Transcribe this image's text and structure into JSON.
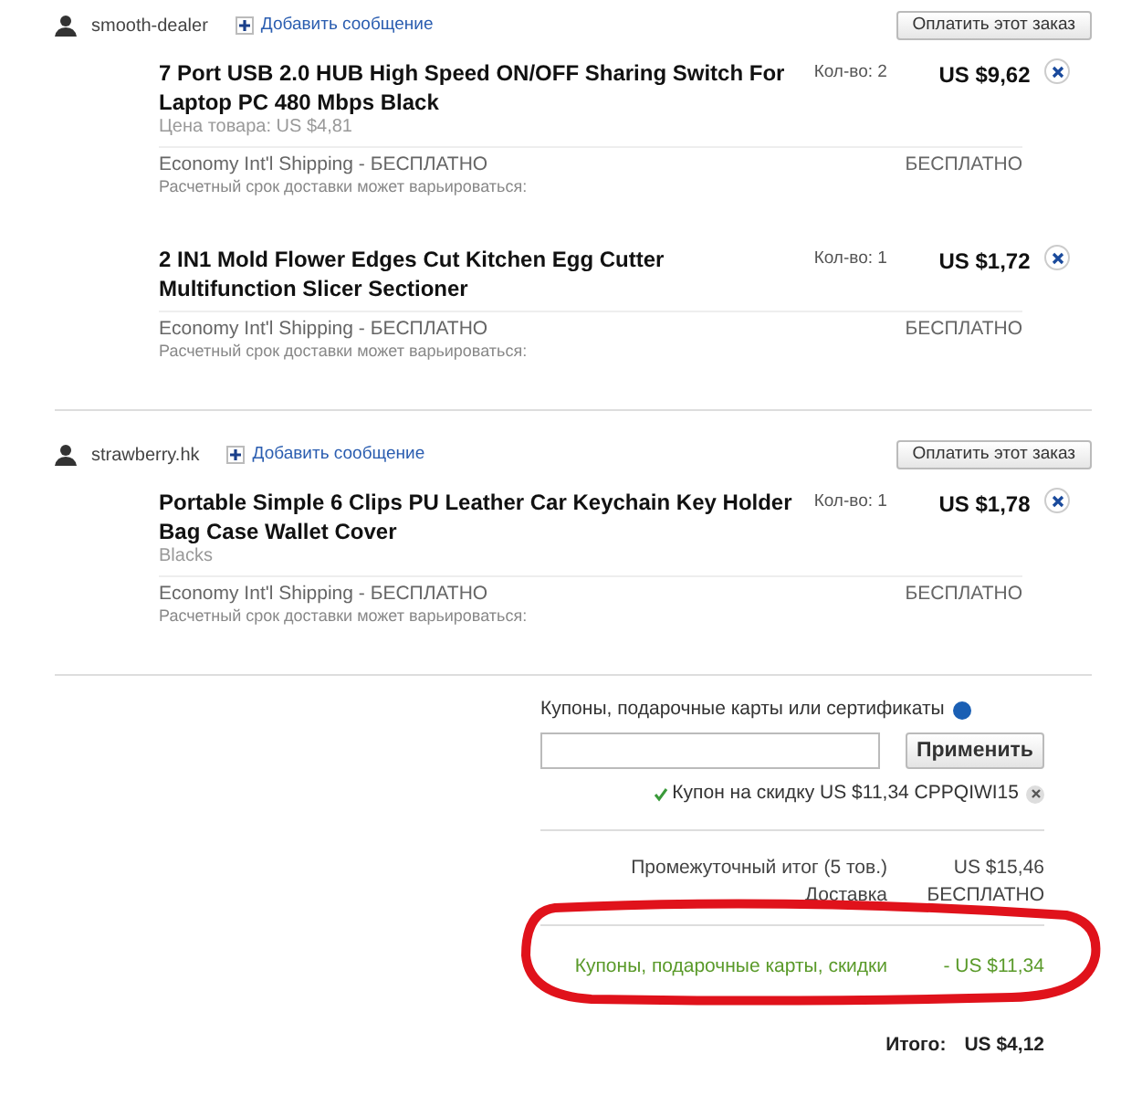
{
  "sellers": [
    {
      "name": "smooth-dealer",
      "add_message": "Добавить сообщение",
      "pay_button": "Оплатить этот заказ",
      "items": [
        {
          "title": "7 Port USB 2.0 HUB High Speed ON/OFF Sharing Switch For Laptop PC 480 Mbps Black",
          "subtitle": "Цена товара: US $4,81",
          "qty": "Кол-во: 2",
          "price": "US $9,62",
          "shipping": "Economy Int'l Shipping - БЕСПЛАТНО",
          "shipping_note": "Расчетный срок доставки может варьироваться:",
          "shipping_price": "БЕСПЛАТНО"
        },
        {
          "title": "2 IN1 Mold Flower Edges Cut Kitchen Egg Cutter Multifunction Slicer Sectioner",
          "qty": "Кол-во: 1",
          "price": "US $1,72",
          "shipping": "Economy Int'l Shipping - БЕСПЛАТНО",
          "shipping_note": "Расчетный срок доставки может варьироваться:",
          "shipping_price": "БЕСПЛАТНО"
        }
      ]
    },
    {
      "name": "strawberry.hk",
      "add_message": "Добавить сообщение",
      "pay_button": "Оплатить этот заказ",
      "items": [
        {
          "title": "Portable Simple 6 Clips PU Leather Car Keychain Key Holder Bag Case Wallet Cover",
          "subtitle": "Blacks",
          "qty": "Кол-во: 1",
          "price": "US $1,78",
          "shipping": "Economy Int'l Shipping - БЕСПЛАТНО",
          "shipping_note": "Расчетный срок доставки может варьироваться:",
          "shipping_price": "БЕСПЛАТНО"
        }
      ]
    }
  ],
  "coupon": {
    "label": "Купоны, подарочные карты или сертификаты",
    "apply_button": "Применить",
    "applied": "Купон на скидку US $11,34 CPPQIWI15"
  },
  "summary": [
    {
      "kind": "normal",
      "label": "Промежуточный итог (5 тов.)",
      "value": "US $15,46"
    },
    {
      "kind": "normal",
      "label": "Доставка",
      "value": "БЕСПЛАТНО"
    },
    {
      "kind": "discount",
      "label": "Купоны, подарочные карты, скидки",
      "value": "- US $11,34"
    }
  ],
  "total": {
    "label": "Итого:",
    "value": "US $4,12"
  }
}
